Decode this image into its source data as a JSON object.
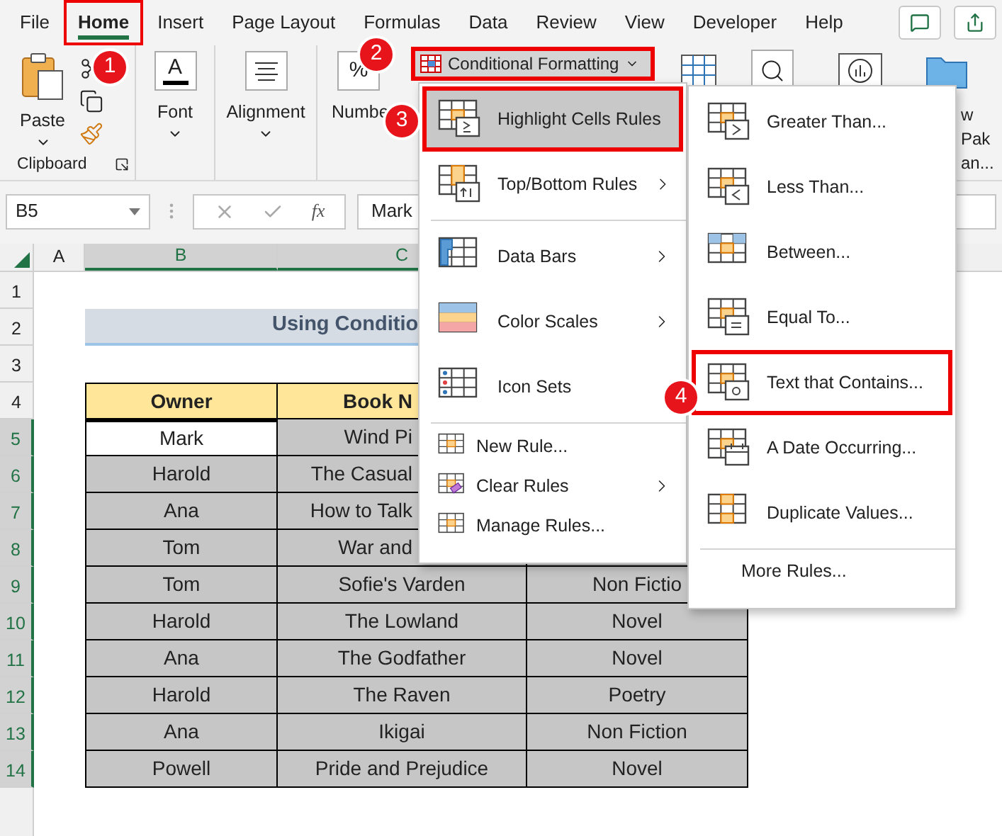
{
  "menu_tabs": [
    {
      "label": "File",
      "selected": false,
      "annotated": false
    },
    {
      "label": "Home",
      "selected": true,
      "annotated": true
    },
    {
      "label": "Insert",
      "selected": false,
      "annotated": false
    },
    {
      "label": "Page Layout",
      "selected": false,
      "annotated": false
    },
    {
      "label": "Formulas",
      "selected": false,
      "annotated": false
    },
    {
      "label": "Data",
      "selected": false,
      "annotated": false
    },
    {
      "label": "Review",
      "selected": false,
      "annotated": false
    },
    {
      "label": "View",
      "selected": false,
      "annotated": false
    },
    {
      "label": "Developer",
      "selected": false,
      "annotated": false
    },
    {
      "label": "Help",
      "selected": false,
      "annotated": false
    }
  ],
  "ribbon": {
    "paste_label": "Paste",
    "clipboard_label": "Clipboard",
    "font": {
      "glyph": "A",
      "label": "Font"
    },
    "alignment": {
      "label": "Alignment"
    },
    "number": {
      "glyph": "%",
      "label": "Numbe"
    },
    "conditional_formatting": {
      "label": "Conditional Formatting",
      "annotated": true
    },
    "cut_lines": [
      "w",
      "Pak",
      "an..."
    ]
  },
  "formula_bar": {
    "name_box": "B5",
    "fx_label": "fx",
    "value": "Mark"
  },
  "column_headers": [
    {
      "label": "A",
      "selected": false
    },
    {
      "label": "B",
      "selected": true
    },
    {
      "label": "C",
      "selected": true
    }
  ],
  "sheet_rows": [
    {
      "number": "1",
      "selected": false,
      "kind": "blank"
    },
    {
      "number": "2",
      "selected": false,
      "kind": "title",
      "cells": [
        {
          "text": "Using Conditio"
        }
      ]
    },
    {
      "number": "3",
      "selected": false,
      "kind": "blank"
    },
    {
      "number": "4",
      "selected": false,
      "kind": "header",
      "cells": [
        {
          "text": "Owner"
        },
        {
          "text": "Book N"
        }
      ]
    },
    {
      "number": "5",
      "selected": true,
      "kind": "data",
      "cells": [
        {
          "text": "Mark",
          "active": true
        },
        {
          "text": "Wind Pi",
          "active": false
        }
      ]
    },
    {
      "number": "6",
      "selected": true,
      "kind": "data",
      "cells": [
        {
          "text": "Harold",
          "active": false
        },
        {
          "text": "The Casual",
          "active": false
        }
      ]
    },
    {
      "number": "7",
      "selected": true,
      "kind": "data",
      "cells": [
        {
          "text": "Ana",
          "active": false
        },
        {
          "text": "How to Talk",
          "active": false
        }
      ]
    },
    {
      "number": "8",
      "selected": true,
      "kind": "data",
      "cells": [
        {
          "text": "Tom",
          "active": false
        },
        {
          "text": "War and",
          "active": false
        }
      ]
    },
    {
      "number": "9",
      "selected": true,
      "kind": "data",
      "cells": [
        {
          "text": "Tom",
          "active": false
        },
        {
          "text": "Sofie's Varden",
          "active": false
        },
        {
          "text": "Non Fictio",
          "active": false
        }
      ]
    },
    {
      "number": "10",
      "selected": true,
      "kind": "data",
      "cells": [
        {
          "text": "Harold",
          "active": false
        },
        {
          "text": "The Lowland",
          "active": false
        },
        {
          "text": "Novel",
          "active": false
        }
      ]
    },
    {
      "number": "11",
      "selected": true,
      "kind": "data",
      "cells": [
        {
          "text": "Ana",
          "active": false
        },
        {
          "text": "The Godfather",
          "active": false
        },
        {
          "text": "Novel",
          "active": false
        }
      ]
    },
    {
      "number": "12",
      "selected": true,
      "kind": "data",
      "cells": [
        {
          "text": "Harold",
          "active": false
        },
        {
          "text": "The Raven",
          "active": false
        },
        {
          "text": "Poetry",
          "active": false
        }
      ]
    },
    {
      "number": "13",
      "selected": true,
      "kind": "data",
      "cells": [
        {
          "text": "Ana",
          "active": false
        },
        {
          "text": "Ikigai",
          "active": false
        },
        {
          "text": "Non Fiction",
          "active": false
        }
      ]
    },
    {
      "number": "14",
      "selected": true,
      "kind": "data",
      "cells": [
        {
          "text": "Powell",
          "active": false
        },
        {
          "text": "Pride and Prejudice",
          "active": false
        },
        {
          "text": "Novel",
          "active": false
        }
      ]
    }
  ],
  "cf_menu": {
    "items": [
      {
        "kind": "large",
        "label": "Highlight Cells Rules",
        "submenu": true,
        "selected": true,
        "annotated": true
      },
      {
        "kind": "large",
        "label": "Top/Bottom Rules",
        "submenu": true,
        "selected": false,
        "annotated": false
      },
      {
        "kind": "separator"
      },
      {
        "kind": "large",
        "label": "Data Bars",
        "submenu": true,
        "selected": false,
        "annotated": false
      },
      {
        "kind": "large",
        "label": "Color Scales",
        "submenu": true,
        "selected": false,
        "annotated": false
      },
      {
        "kind": "large",
        "label": "Icon Sets",
        "submenu": false,
        "selected": false,
        "annotated": false
      },
      {
        "kind": "separator"
      },
      {
        "kind": "small",
        "label": "New Rule...",
        "submenu": false,
        "selected": false,
        "annotated": false
      },
      {
        "kind": "small",
        "label": "Clear Rules",
        "submenu": true,
        "selected": false,
        "annotated": false
      },
      {
        "kind": "small",
        "label": "Manage Rules...",
        "submenu": false,
        "selected": false,
        "annotated": false
      }
    ]
  },
  "submenu": {
    "items": [
      {
        "kind": "large",
        "label": "Greater Than...",
        "selected": false,
        "annotated": false
      },
      {
        "kind": "large",
        "label": "Less Than...",
        "selected": false,
        "annotated": false
      },
      {
        "kind": "large",
        "label": "Between...",
        "selected": false,
        "annotated": false
      },
      {
        "kind": "large",
        "label": "Equal To...",
        "selected": false,
        "annotated": false
      },
      {
        "kind": "large",
        "label": "Text that Contains...",
        "selected": false,
        "annotated": true
      },
      {
        "kind": "large",
        "label": "A Date Occurring...",
        "selected": false,
        "annotated": false
      },
      {
        "kind": "large",
        "label": "Duplicate Values...",
        "selected": false,
        "annotated": false
      },
      {
        "kind": "separator"
      },
      {
        "kind": "more",
        "label": "More Rules...",
        "selected": false,
        "annotated": false
      }
    ]
  },
  "callouts": [
    "1",
    "2",
    "3",
    "4"
  ]
}
